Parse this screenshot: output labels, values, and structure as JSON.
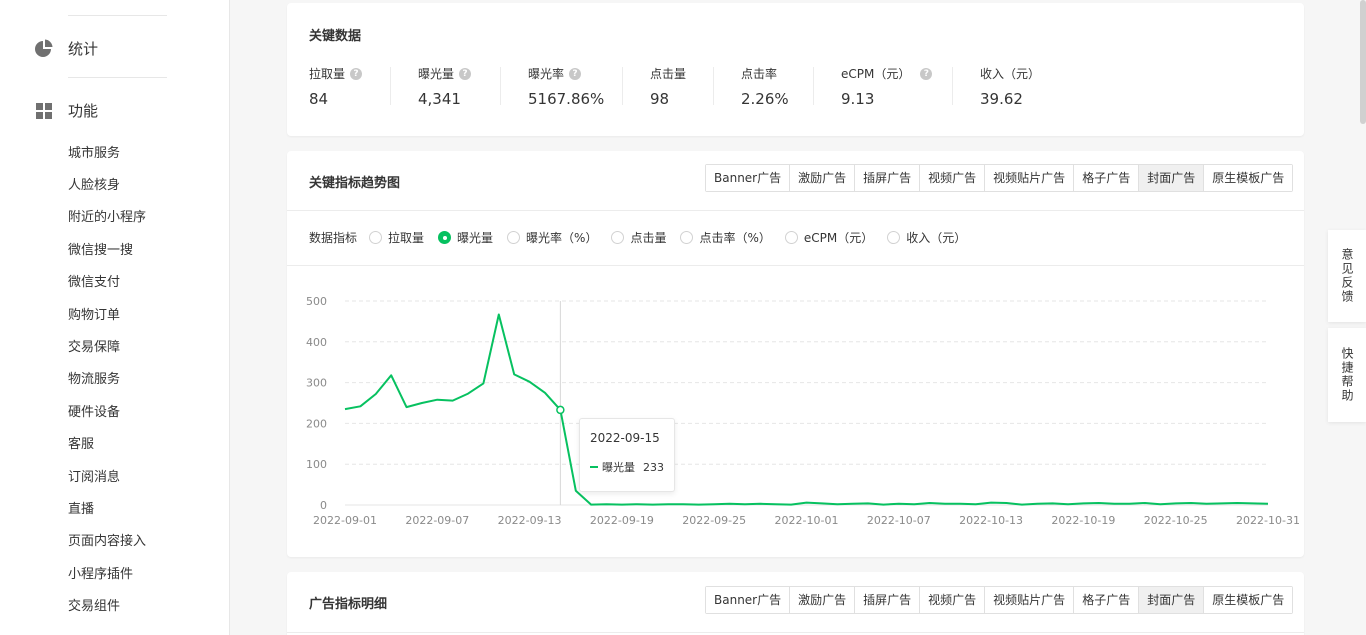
{
  "sidebar": {
    "stats_label": "统计",
    "features_label": "功能",
    "items": [
      {
        "label": "城市服务"
      },
      {
        "label": "人脸核身"
      },
      {
        "label": "附近的小程序"
      },
      {
        "label": "微信搜一搜"
      },
      {
        "label": "微信支付"
      },
      {
        "label": "购物订单"
      },
      {
        "label": "交易保障"
      },
      {
        "label": "物流服务"
      },
      {
        "label": "硬件设备"
      },
      {
        "label": "客服"
      },
      {
        "label": "订阅消息"
      },
      {
        "label": "直播"
      },
      {
        "label": "页面内容接入"
      },
      {
        "label": "小程序插件"
      },
      {
        "label": "交易组件"
      }
    ]
  },
  "key_data": {
    "title": "关键数据",
    "stats": [
      {
        "label": "拉取量",
        "value": "84",
        "help": true
      },
      {
        "label": "曝光量",
        "value": "4,341",
        "help": true
      },
      {
        "label": "曝光率",
        "value": "5167.86%",
        "help": true
      },
      {
        "label": "点击量",
        "value": "98",
        "help": false
      },
      {
        "label": "点击率",
        "value": "2.26%",
        "help": false
      },
      {
        "label": "eCPM（元）",
        "value": "9.13",
        "help": true
      },
      {
        "label": "收入（元）",
        "value": "39.62",
        "help": false
      }
    ]
  },
  "trend": {
    "title": "关键指标趋势图",
    "tabs": [
      "Banner广告",
      "激励广告",
      "插屏广告",
      "视频广告",
      "视频贴片广告",
      "格子广告",
      "封面广告",
      "原生模板广告"
    ],
    "active_tab": "封面广告",
    "metric_label": "数据指标",
    "metrics": [
      "拉取量",
      "曝光量",
      "曝光率（%）",
      "点击量",
      "点击率（%）",
      "eCPM（元）",
      "收入（元）"
    ],
    "selected_metric": "曝光量",
    "tooltip": {
      "date": "2022-09-15",
      "series": "曝光量",
      "value": "233"
    }
  },
  "detail": {
    "title": "广告指标明细",
    "tabs": [
      "Banner广告",
      "激励广告",
      "插屏广告",
      "视频广告",
      "视频贴片广告",
      "格子广告",
      "封面广告",
      "原生模板广告"
    ],
    "active_tab": "封面广告"
  },
  "floating": {
    "feedback": "意见反馈",
    "help": "快捷帮助"
  },
  "colors": {
    "accent": "#07c160",
    "line": "#07c160"
  },
  "chart_data": {
    "type": "line",
    "xlabel": "",
    "ylabel": "",
    "ylim": [
      0,
      500
    ],
    "yticks": [
      0,
      100,
      200,
      300,
      400,
      500
    ],
    "xtick_labels": [
      "2022-09-01",
      "2022-09-07",
      "2022-09-13",
      "2022-09-19",
      "2022-09-25",
      "2022-10-01",
      "2022-10-07",
      "2022-10-13",
      "2022-10-19",
      "2022-10-25",
      "2022-10-31"
    ],
    "x_start": "2022-09-01",
    "series": [
      {
        "name": "曝光量",
        "values": [
          235,
          242,
          272,
          318,
          240,
          250,
          258,
          256,
          273,
          298,
          467,
          320,
          302,
          275,
          233,
          35,
          1,
          2,
          1,
          2,
          1,
          2,
          2,
          1,
          2,
          3,
          2,
          3,
          2,
          1,
          6,
          4,
          2,
          3,
          4,
          1,
          3,
          2,
          5,
          3,
          3,
          2,
          6,
          5,
          1,
          3,
          4,
          2,
          4,
          5,
          3,
          3,
          5,
          2,
          4,
          5,
          3,
          4,
          5,
          4,
          3
        ]
      }
    ]
  }
}
